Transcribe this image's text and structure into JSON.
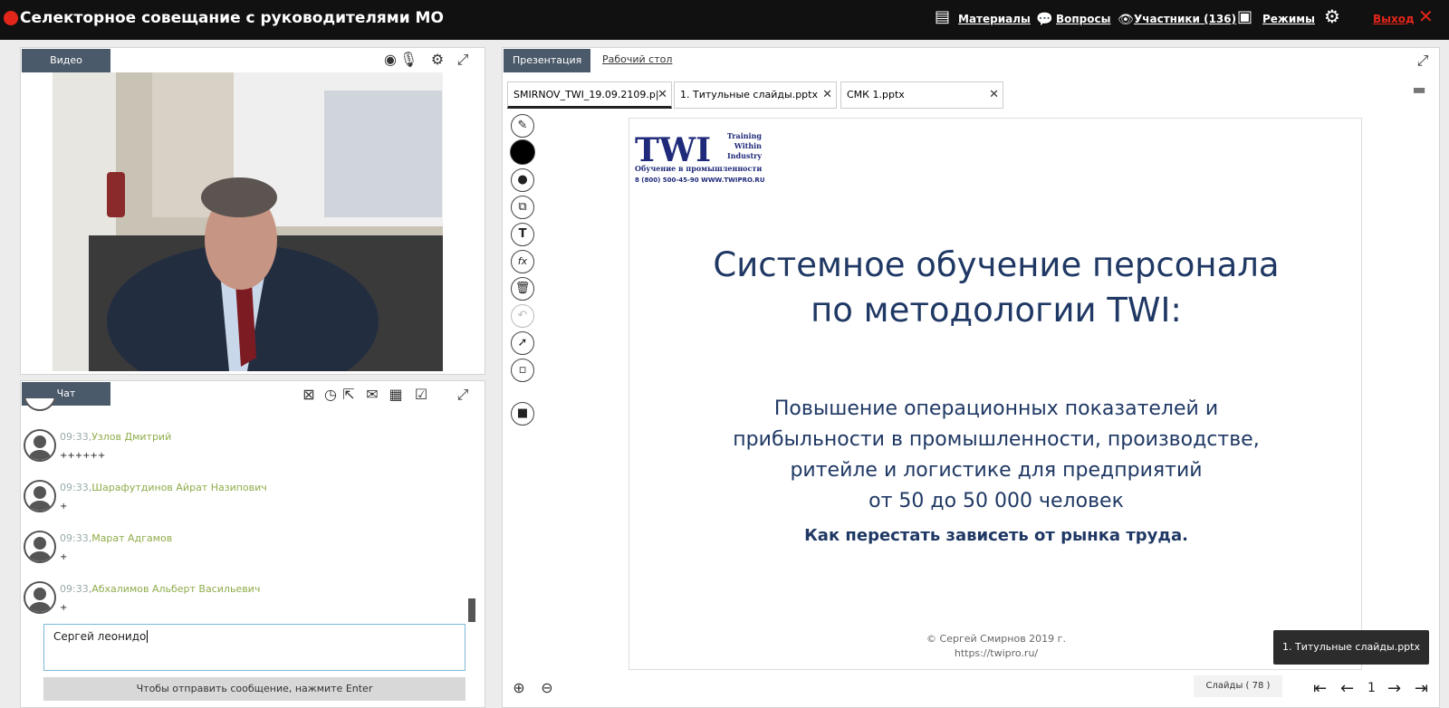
{
  "topbar": {
    "title": "Селекторное совещание с руководителями МО",
    "materials": "Материалы",
    "questions": "Вопросы",
    "participants": "Участники (136)",
    "modes": "Режимы",
    "exit": "Выход"
  },
  "video_panel": {
    "tab": "Видео"
  },
  "chat_panel": {
    "tab": "Чат",
    "messages": [
      {
        "time": "09:33,",
        "author": "Узлов Дмитрий",
        "text": "++++++"
      },
      {
        "time": "09:33,",
        "author": "Шарафутдинов Айрат Назипович",
        "text": "+"
      },
      {
        "time": "09:33,",
        "author": "Марат Адгамов",
        "text": "+"
      },
      {
        "time": "09:33,",
        "author": "Абхалимов Альберт Васильевич",
        "text": "+"
      }
    ],
    "input_value": "Сергей леонидо",
    "send_hint": "Чтобы отправить сообщение, нажмите Enter"
  },
  "presentation": {
    "tab_active": "Презентация",
    "tab_desktop": "Рабочий стол",
    "files": [
      "SMIRNOV_TWI_19.09.2109.p|",
      "1. Титульные слайды.pptx",
      "СМК 1.pptx"
    ],
    "slide": {
      "logo_text": "TWI",
      "logo_side": [
        "Training",
        "Within",
        "Industry"
      ],
      "logo_sub": "Обучение в промышленности",
      "logo_phone": "8 (800) 500-45-90   WWW.TWIPRO.RU",
      "title_line1": "Системное обучение персонала",
      "title_line2": "по методологии TWI:",
      "sub_line1": "Повышение операционных показателей и",
      "sub_line2": "прибыльности в промышленности, производстве,",
      "sub_line3": "ритейле и логистике для предприятий",
      "sub_line4": "от 50 до 50 000 человек",
      "bold_line": "Как перестать зависеть от рынка труда.",
      "footer1": "© Сергей Смирнов 2019 г.",
      "footer2": "https://twipro.ru/"
    },
    "tooltip": "1. Титульные слайды.pptx",
    "slides_label": "Слайды (",
    "slides_count": "78",
    "slides_close": ")",
    "current_page": "1"
  },
  "colors": {
    "topbar": "#111111",
    "accent_red": "#e3261a",
    "tab_dark": "#4b5a6a",
    "slide_text": "#1f3864",
    "chat_author": "#8fac4a"
  }
}
